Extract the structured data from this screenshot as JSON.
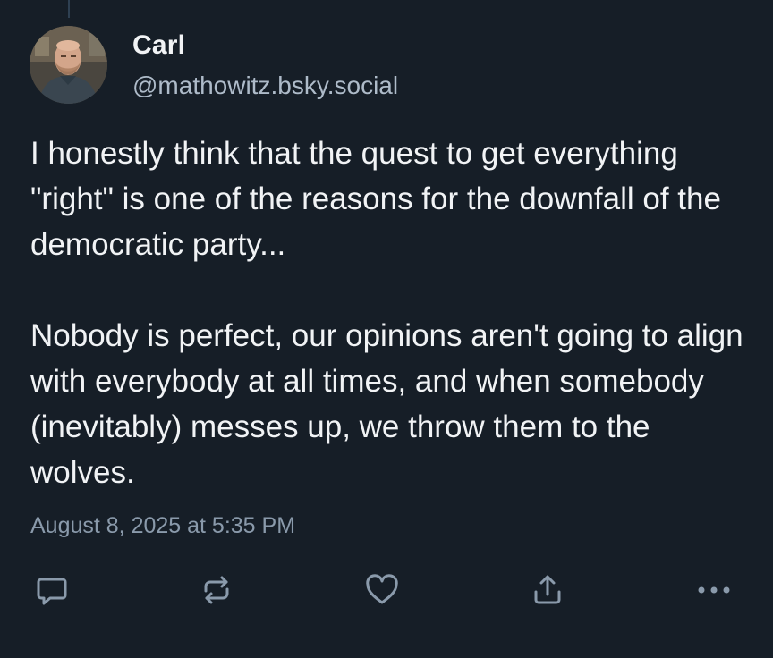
{
  "post": {
    "author": {
      "name": "Carl",
      "handle": "@mathowitz.bsky.social"
    },
    "text_paragraphs": [
      "I honestly think that the quest to get everything \"right\" is one of the reasons for the downfall of the democratic party...",
      "Nobody is perfect, our opinions aren't going to align with everybody at all times, and when somebody (inevitably) messes up, we throw them to the wolves."
    ],
    "timestamp": "August 8, 2025 at 5:35 PM"
  },
  "actions": [
    {
      "id": "reply",
      "icon": "reply-icon"
    },
    {
      "id": "repost",
      "icon": "repost-icon"
    },
    {
      "id": "like",
      "icon": "heart-icon"
    },
    {
      "id": "share",
      "icon": "share-icon"
    },
    {
      "id": "more",
      "icon": "more-options-icon"
    }
  ],
  "colors": {
    "background": "#161e27",
    "text_primary": "#f1f3f5",
    "text_secondary": "#aebbc9",
    "icon": "#8a9aab"
  }
}
